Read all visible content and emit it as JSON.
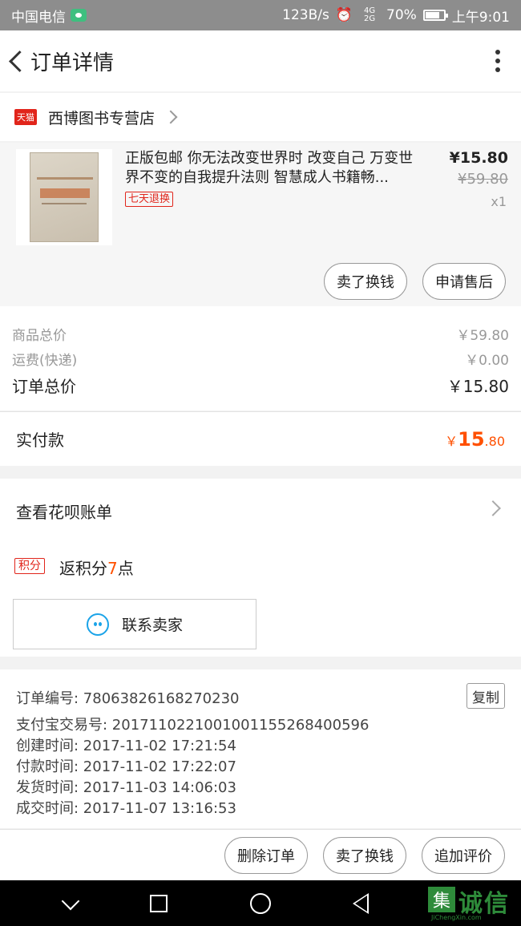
{
  "status_bar": {
    "carrier": "中国电信",
    "speed": "123B/s",
    "network": "4G\n2G",
    "battery": "70%",
    "time": "上午9:01"
  },
  "header": {
    "title": "订单详情"
  },
  "shop": {
    "badge": "天猫",
    "name": "西博图书专营店"
  },
  "product": {
    "title": "正版包邮 你无法改变世界时 改变自己 万变世界不变的自我提升法则 智慧成人书籍畅...",
    "badge": "七天退换",
    "price": "¥15.80",
    "original_price": "¥59.80",
    "quantity": "x1",
    "buttons": [
      "卖了换钱",
      "申请售后"
    ]
  },
  "summary": {
    "goods_total_label": "商品总价",
    "goods_total": "￥59.80",
    "shipping_label": "运费(快递)",
    "shipping": "￥0.00",
    "order_total_label": "订单总价",
    "order_total": "￥15.80"
  },
  "payment": {
    "label": "实付款",
    "currency": "￥",
    "integer": "15",
    "decimal": ".80"
  },
  "extras": {
    "huabei_label": "查看花呗账单",
    "points_badge": "积分",
    "points_prefix": "返积分",
    "points_value": "7",
    "points_suffix": "点",
    "contact_label": "联系卖家"
  },
  "order_info": {
    "order_no": "订单编号: 78063826168270230",
    "alipay_no": "支付宝交易号: 2017110221001001155268400596",
    "created": "创建时间: 2017-11-02 17:21:54",
    "paid": "付款时间: 2017-11-02 17:22:07",
    "shipped": "发货时间: 2017-11-03 14:06:03",
    "completed": "成交时间: 2017-11-07 13:16:53",
    "copy_label": "复制"
  },
  "actions": {
    "delete": "删除订单",
    "sell": "卖了换钱",
    "review": "追加评价"
  },
  "watermark": {
    "box": "集",
    "text": "诚信",
    "url": "JiChengXin.com"
  },
  "colors": {
    "accent": "#ff5000",
    "tmall_red": "#e1251b",
    "wangwang_blue": "#1aa3e8"
  }
}
